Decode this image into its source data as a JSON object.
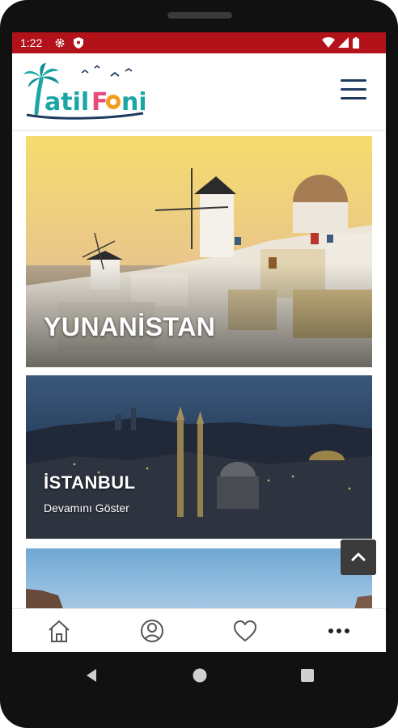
{
  "status_bar": {
    "time": "1:22"
  },
  "app": {
    "logo_text": "tatilFoni"
  },
  "cards": [
    {
      "title": "YUNANİSTAN",
      "link": ""
    },
    {
      "title": "İSTANBUL",
      "link": "Devamını Göster"
    },
    {
      "title": "",
      "link": ""
    }
  ],
  "colors": {
    "status_bar": "#b3121b",
    "menu_icon": "#1f3a5f",
    "logo_teal": "#1ba6a6",
    "logo_pink": "#e84b7a",
    "logo_orange": "#f39c1f"
  },
  "icons": {
    "home": "home-icon",
    "profile": "user-circle-icon",
    "favorites": "heart-icon",
    "more": "more-dots-icon",
    "scroll_top": "chevron-up-icon"
  }
}
